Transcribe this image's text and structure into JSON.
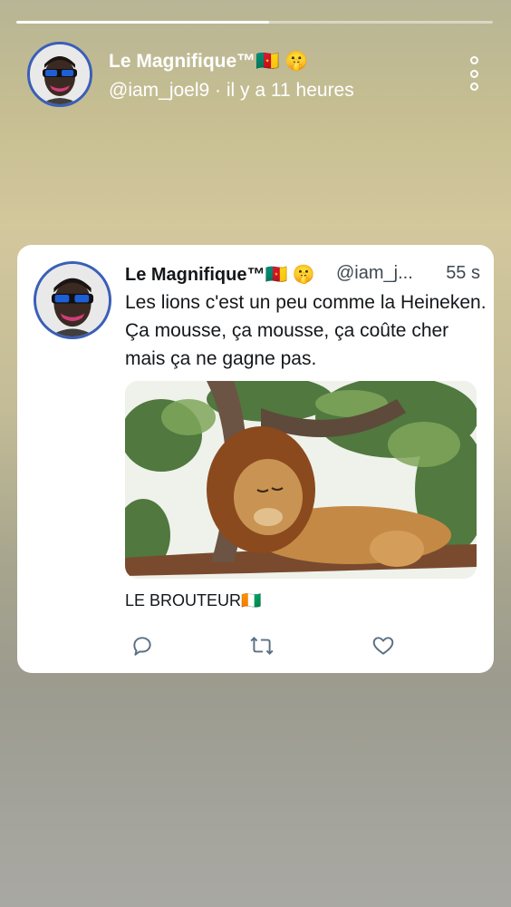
{
  "story": {
    "progress": 0.53,
    "user_name": "Le Magnifique™",
    "flag_emoji": "🇨🇲",
    "reaction_emoji": "🤫",
    "handle": "@iam_joel9",
    "time_ago": " · il y a 11 heures",
    "menu_icon": "more-vertical-icon"
  },
  "tweet": {
    "user_name": "Le Magnifique™",
    "flag_emoji": "🇨🇲",
    "reaction_emoji": "🤫",
    "handle": "@iam_j...",
    "time": "55 s",
    "text": "Les lions c'est un peu comme la Heineken. Ça mousse, ça mousse, ça coûte cher mais ça ne gagne pas.",
    "image_subject": "lion resting in a tree",
    "caption": "LE BROUTEUR",
    "caption_flag": "🇨🇮",
    "actions": [
      {
        "icon": "reply-icon"
      },
      {
        "icon": "retweet-icon"
      },
      {
        "icon": "like-heart-icon"
      }
    ]
  },
  "colors": {
    "avatar_ring": "#3a5fb8",
    "card_bg": "#ffffff",
    "text": "#14171a",
    "muted": "#3d4852",
    "action_icon": "#5b7083"
  }
}
